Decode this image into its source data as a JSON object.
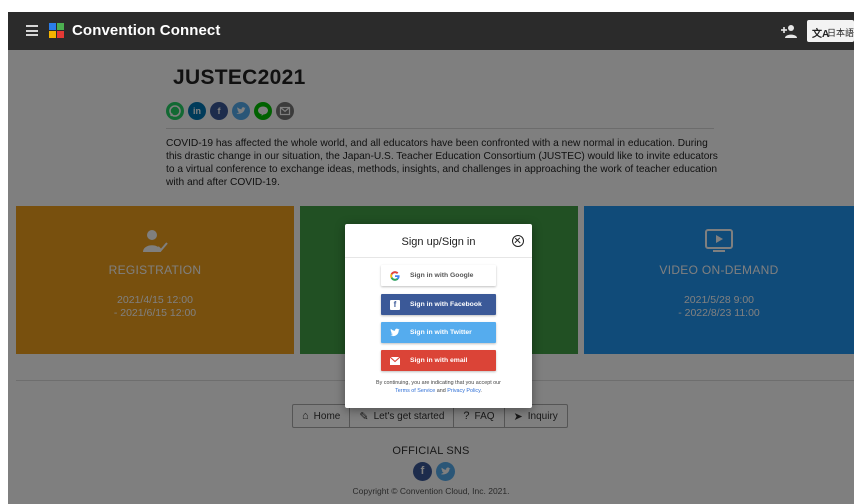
{
  "app": {
    "title": "Convention Connect",
    "language_label": "日本語",
    "translate_glyph": "文A"
  },
  "event": {
    "title": "JUSTEC2021",
    "description": "COVID-19 has affected the whole world, and all educators have been confronted with a new normal in education. During this drastic change in our situation, the Japan-U.S. Teacher Education Consortium (JUSTEC) would like to invite educators to a virtual conference to exchange ideas, methods, insights, and challenges in approaching the work of teacher education with and after COVID-19.",
    "share_icons": [
      "whatsapp-icon",
      "linkedin-icon",
      "facebook-icon",
      "twitter-icon",
      "line-icon",
      "mail-icon"
    ]
  },
  "tiles": {
    "registration": {
      "name": "REGISTRATION",
      "date_start": "2021/4/15 12:00",
      "date_end": "- 2021/6/15 12:00",
      "color": "#f1a01c"
    },
    "middle": {
      "color": "#43a047"
    },
    "video": {
      "name": "VIDEO ON-DEMAND",
      "date_start": "2021/5/28 9:00",
      "date_end": "- 2022/8/23 11:00",
      "color": "#2196f3"
    }
  },
  "footer_nav": [
    {
      "label": "Home",
      "icon": "home-icon"
    },
    {
      "label": "Let's get started",
      "icon": "pencil-icon"
    },
    {
      "label": "FAQ",
      "icon": "question-icon"
    },
    {
      "label": "Inquiry",
      "icon": "send-icon"
    }
  ],
  "sns": {
    "title": "OFFICIAL SNS",
    "icons": [
      "facebook-icon",
      "twitter-icon"
    ]
  },
  "copyright": "Copyright © Convention Cloud, Inc. 2021.",
  "modal": {
    "title": "Sign up/Sign in",
    "buttons": {
      "google": "Sign in with Google",
      "facebook": "Sign in with Facebook",
      "twitter": "Sign in with Twitter",
      "email": "Sign in with email"
    },
    "legal_text": "By continuing, you are indicating that you accept our",
    "terms_label": "Terms of Service",
    "and_label": "and",
    "privacy_label": "Privacy Policy",
    "period": "."
  },
  "colors": {
    "topbar": "#2b2b2b",
    "google_blue": "#4285f4",
    "facebook": "#3b5998",
    "twitter": "#55acee",
    "email": "#db4437",
    "whatsapp": "#25d366",
    "linkedin": "#0077b5",
    "line": "#00c300"
  }
}
